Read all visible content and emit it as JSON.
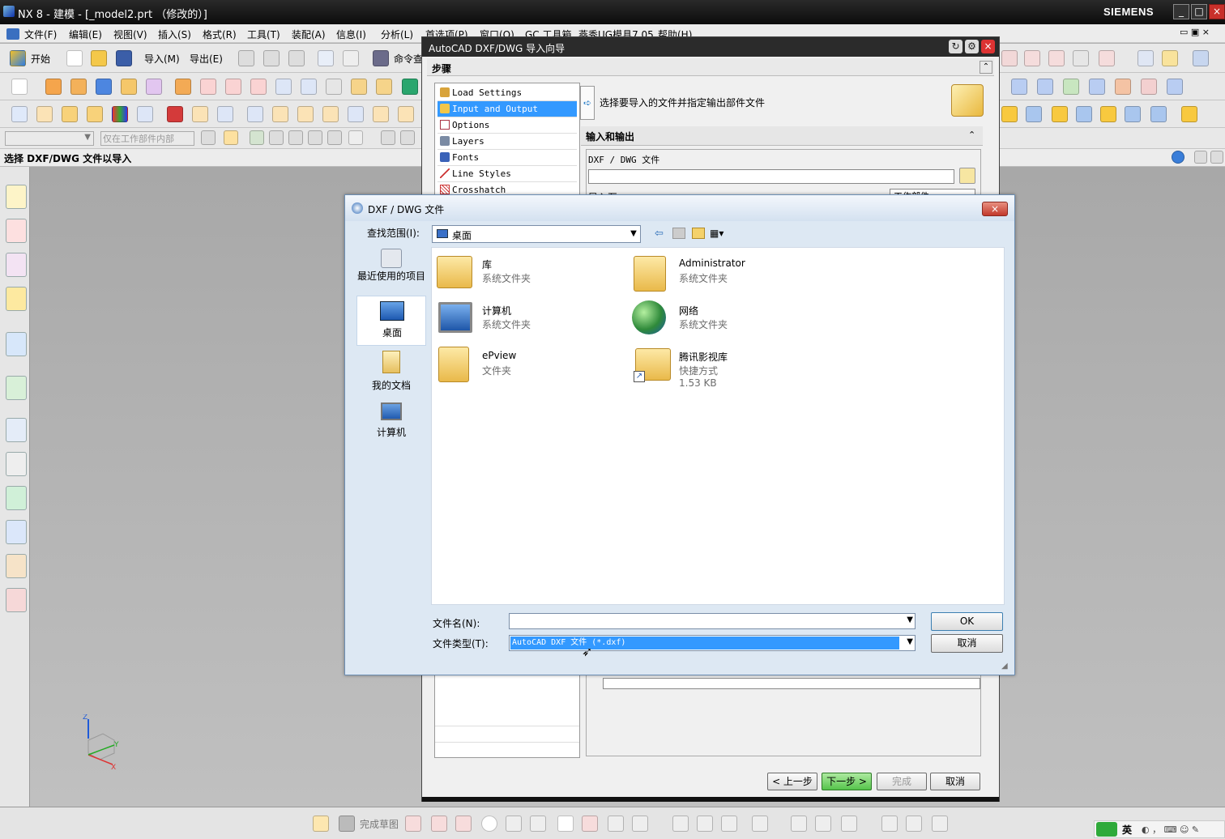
{
  "window": {
    "title": "NX 8 - 建模 - [_model2.prt （修改的）]",
    "brand": "SIEMENS"
  },
  "menu": [
    "文件(F)",
    "编辑(E)",
    "视图(V)",
    "插入(S)",
    "格式(R)",
    "工具(T)",
    "装配(A)",
    "信息(I)",
    "分析(L)",
    "首选项(P)",
    "窗口(O)",
    "GC 工具箱",
    "燕秀UG模具7.05",
    "帮助(H)"
  ],
  "toolbar": {
    "start": "开始",
    "import": "导入(M)",
    "export": "导出(E)",
    "command_finder": "命令查",
    "filter_combo": "",
    "scope_combo": "仅在工作部件内部"
  },
  "cue_line": "选择 DXF/DWG 文件以导入",
  "wizard": {
    "title": "AutoCAD DXF/DWG 导入向导",
    "steps_header": "步骤",
    "steps": [
      "Load Settings",
      "Input and Output",
      "Options",
      "Layers",
      "Fonts",
      "Line Styles",
      "Crosshatch"
    ],
    "selected_step": 1,
    "instruction": "选择要导入的文件并指定输出部件文件",
    "section": "输入和输出",
    "file_label": "DXF / DWG 文件",
    "file_value": "",
    "import_to_label": "导入至",
    "import_to_value": "工作部件",
    "buttons": {
      "back": "< 上一步",
      "next": "下一步 >",
      "finish": "完成",
      "cancel": "取消"
    }
  },
  "file_dialog": {
    "title": "DXF / DWG 文件",
    "look_in_label": "查找范围(I):",
    "look_in_value": "桌面",
    "places": [
      "最近使用的项目",
      "桌面",
      "我的文档",
      "计算机"
    ],
    "items": [
      {
        "name": "库",
        "type": "系统文件夹",
        "size": ""
      },
      {
        "name": "Administrator",
        "type": "系统文件夹",
        "size": ""
      },
      {
        "name": "计算机",
        "type": "系统文件夹",
        "size": ""
      },
      {
        "name": "网络",
        "type": "系统文件夹",
        "size": ""
      },
      {
        "name": "ePview",
        "type": "文件夹",
        "size": ""
      },
      {
        "name": "腾讯影视库",
        "type": "快捷方式",
        "size": "1.53 KB"
      }
    ],
    "filename_label": "文件名(N):",
    "filename_value": "",
    "filetype_label": "文件类型(T):",
    "filetype_value": "AutoCAD DXF 文件 (*.dxf)",
    "ok": "OK",
    "cancel": "取消"
  },
  "bottom": {
    "finish_sketch": "完成草图"
  },
  "ime": {
    "lang": "英"
  },
  "axis": {
    "z": "Z",
    "y": "Y",
    "x": "X"
  }
}
